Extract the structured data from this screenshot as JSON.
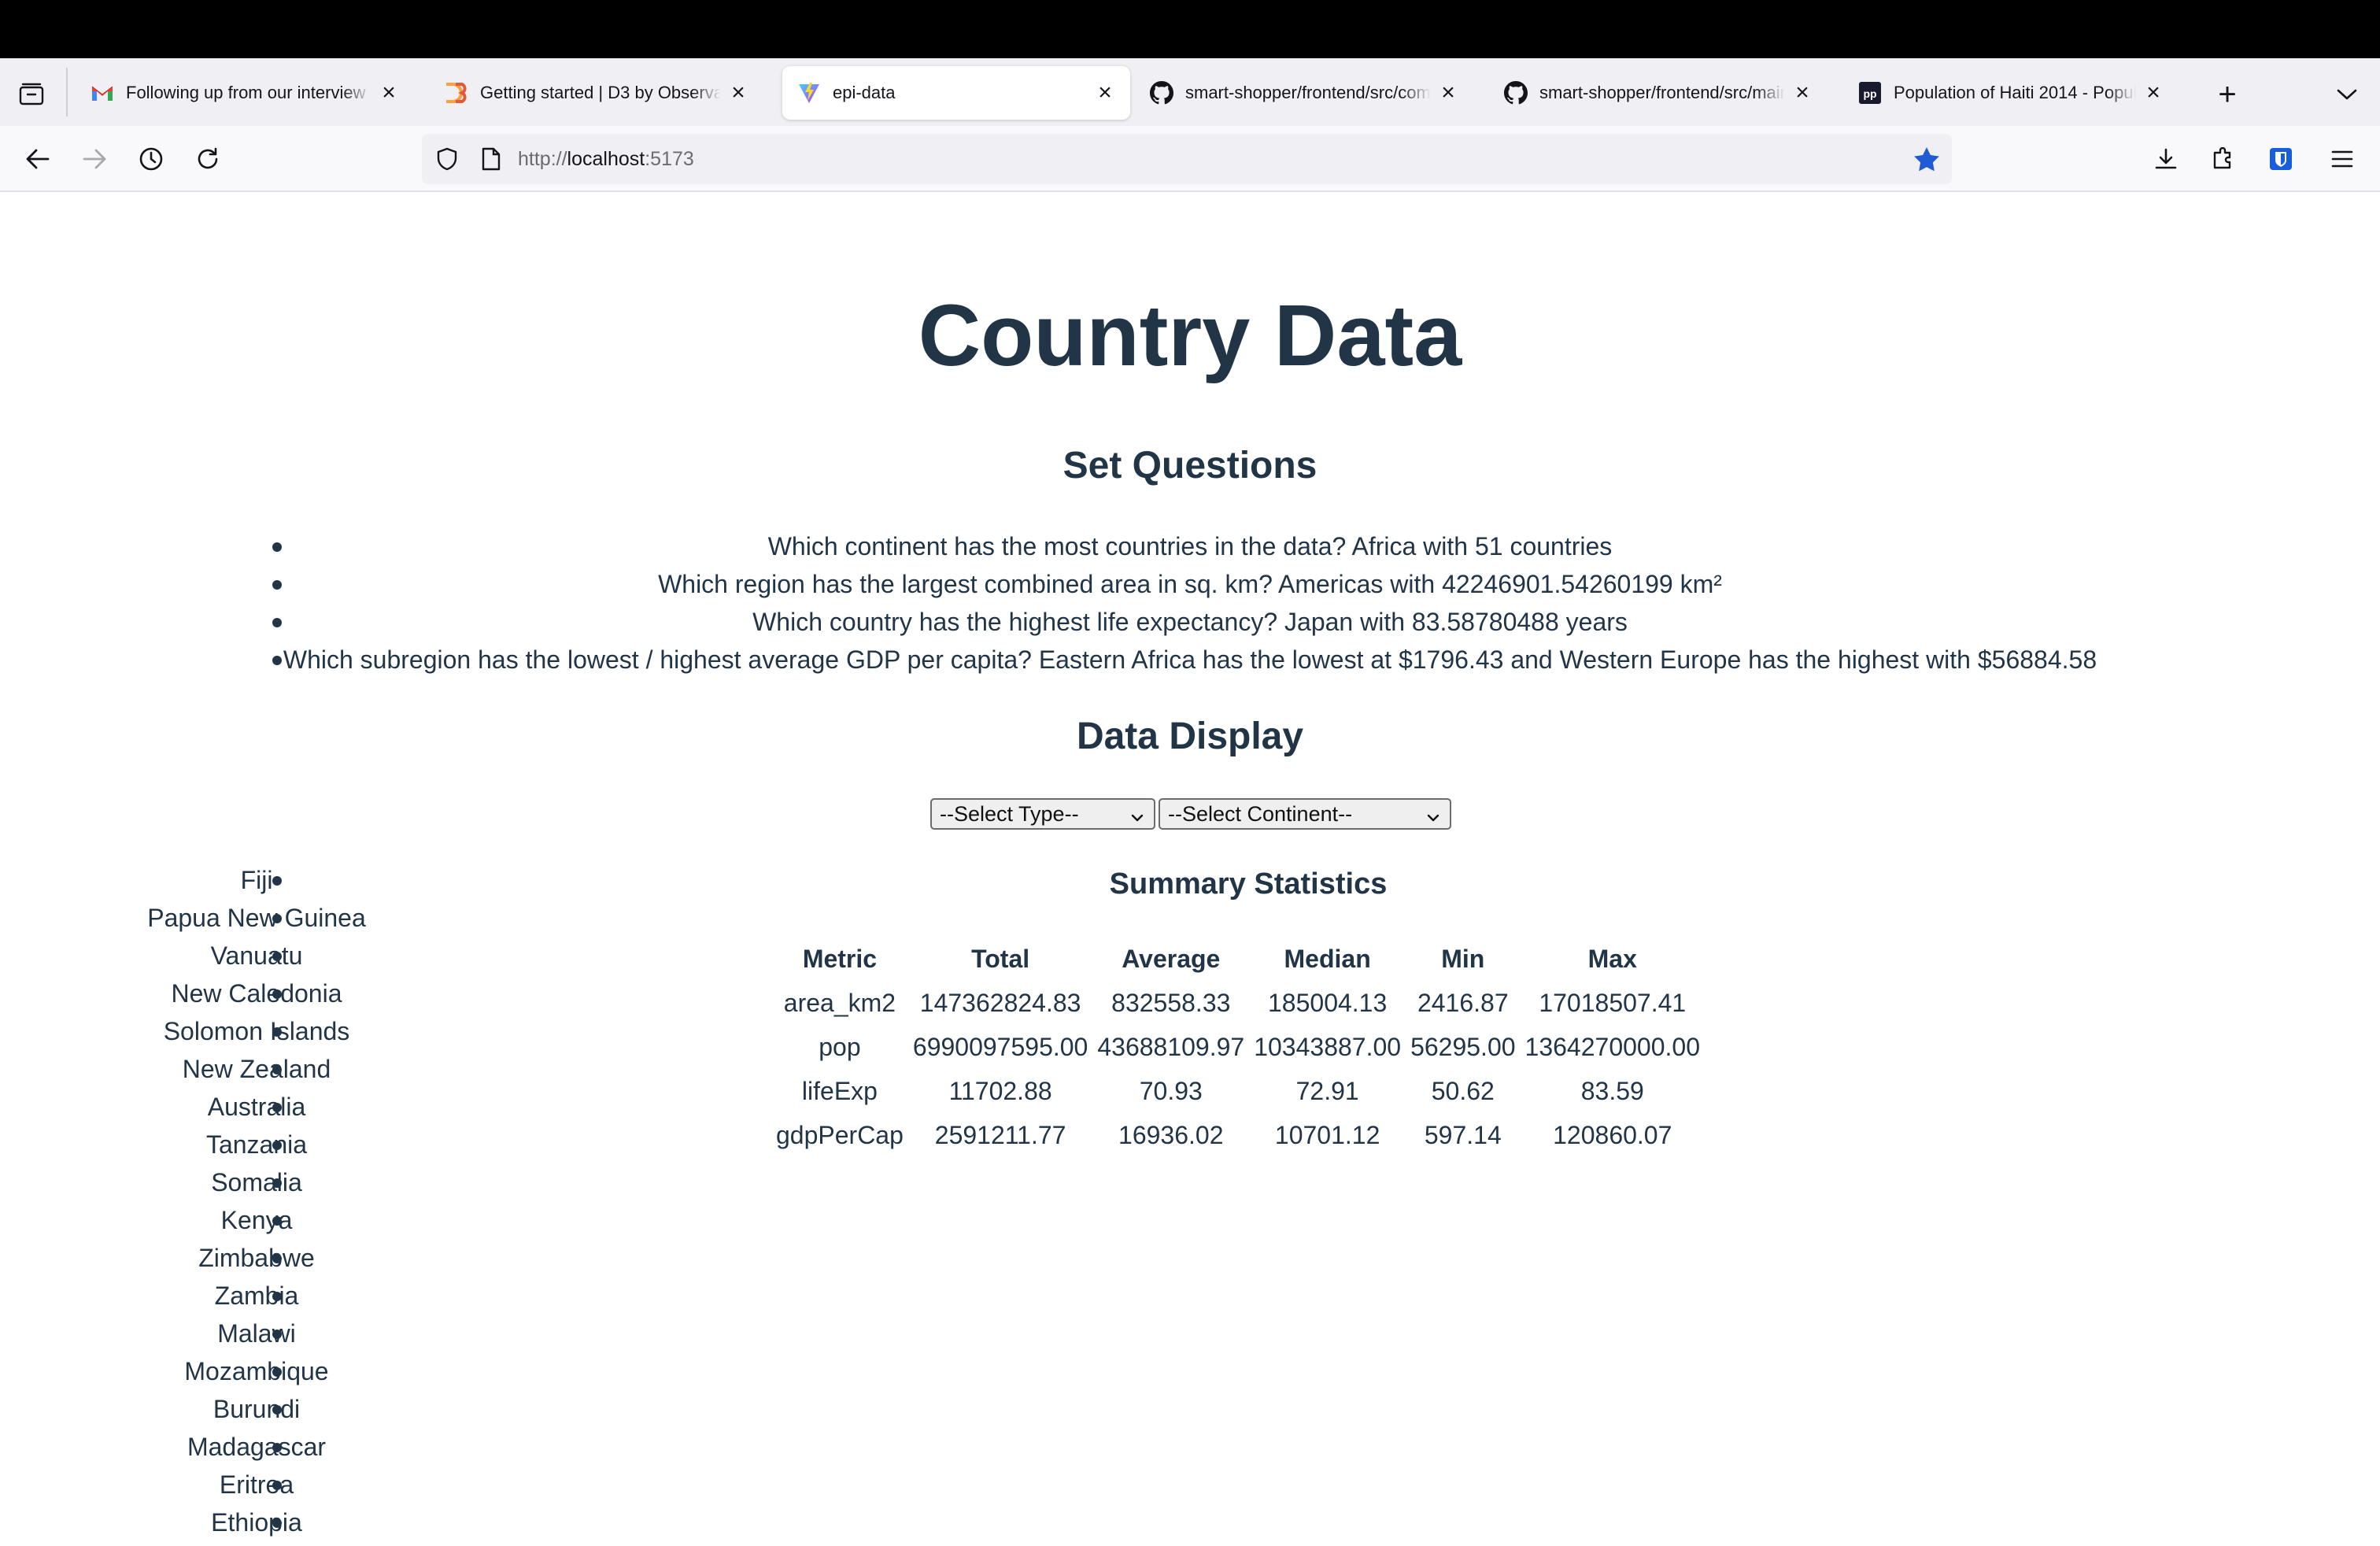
{
  "browser": {
    "tabs": [
      {
        "title": "Following up from our interview",
        "favicon": "gmail-icon",
        "active": false
      },
      {
        "title": "Getting started | D3 by Observable",
        "favicon": "d3-icon",
        "active": false
      },
      {
        "title": "epi-data",
        "favicon": "vite-icon",
        "active": true
      },
      {
        "title": "smart-shopper/frontend/src/components",
        "favicon": "github-icon",
        "active": false
      },
      {
        "title": "smart-shopper/frontend/src/main",
        "favicon": "github-icon",
        "active": false
      },
      {
        "title": "Population of Haiti 2014 - Population",
        "favicon": "pp-icon",
        "active": false
      }
    ],
    "url_scheme": "http://",
    "url_host": "localhost",
    "url_port": ":5173",
    "bookmarked": true,
    "accent_color": "#1f5bd6"
  },
  "page": {
    "title": "Country Data",
    "questions_heading": "Set Questions",
    "questions": [
      "Which continent has the most countries in the data? Africa with 51 countries",
      "Which region has the largest combined area in sq. km? Americas with 42246901.54260199 km²",
      "Which country has the highest life expectancy? Japan with 83.58780488 years",
      "Which subregion has the lowest / highest average GDP per capita? Eastern Africa has the lowest at $1796.43 and Western Europe has the highest with $56884.58"
    ],
    "data_heading": "Data Display",
    "select_type": "--Select Type--",
    "select_continent": "--Select Continent--",
    "countries": [
      "Fiji",
      "Papua New Guinea",
      "Vanuatu",
      "New Caledonia",
      "Solomon Islands",
      "New Zealand",
      "Australia",
      "Tanzania",
      "Somalia",
      "Kenya",
      "Zimbabwe",
      "Zambia",
      "Malawi",
      "Mozambique",
      "Burundi",
      "Madagascar",
      "Eritrea",
      "Ethiopia"
    ],
    "stats_title": "Summary Statistics",
    "stats_headers": [
      "Metric",
      "Total",
      "Average",
      "Median",
      "Min",
      "Max"
    ],
    "stats_rows": [
      [
        "area_km2",
        "147362824.83",
        "832558.33",
        "185004.13",
        "2416.87",
        "17018507.41"
      ],
      [
        "pop",
        "6990097595.00",
        "43688109.97",
        "10343887.00",
        "56295.00",
        "1364270000.00"
      ],
      [
        "lifeExp",
        "11702.88",
        "70.93",
        "72.91",
        "50.62",
        "83.59"
      ],
      [
        "gdpPerCap",
        "2591211.77",
        "16936.02",
        "10701.12",
        "597.14",
        "120860.07"
      ]
    ]
  }
}
